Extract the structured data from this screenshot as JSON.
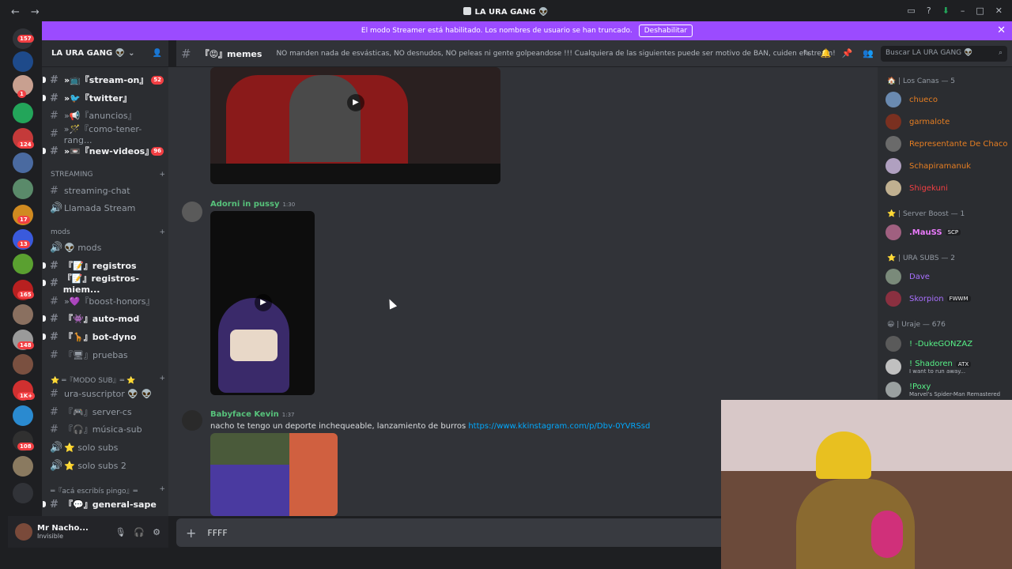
{
  "window": {
    "title": "LA URA GANG 👽"
  },
  "banner": {
    "text": "El modo Streamer está habilitado. Los nombres de usuario se han truncado.",
    "button": "Deshabilitar"
  },
  "server": {
    "name": "LA URA GANG 👽"
  },
  "guild_badges": [
    "157",
    "1",
    "124",
    "17",
    "13",
    "165",
    "148",
    "1K+",
    "108"
  ],
  "channels": {
    "items": [
      {
        "label": "»📺『stream-on』",
        "badge": "52"
      },
      {
        "label": "»🐦『twitter』",
        "badge": ""
      },
      {
        "label": "»📢『anuncios』",
        "badge": ""
      },
      {
        "label": "»🪄『como-tener-rang...",
        "badge": ""
      },
      {
        "label": "»📼『new-videos』",
        "badge": "96"
      },
      {
        "label": "streaming-chat",
        "badge": ""
      },
      {
        "label": "Llamada Stream",
        "badge": ""
      },
      {
        "label": "👽 mods",
        "badge": ""
      },
      {
        "label": "『📝』registros",
        "badge": ""
      },
      {
        "label": "『📝』registros-miem...",
        "badge": ""
      },
      {
        "label": "»💜『boost-honors』",
        "badge": ""
      },
      {
        "label": "『👾』auto-mod",
        "badge": ""
      },
      {
        "label": "『🦒』bot-dyno",
        "badge": ""
      },
      {
        "label": "『🖥』pruebas",
        "badge": ""
      },
      {
        "label": "ura-suscriptor 👽 👽",
        "badge": ""
      },
      {
        "label": "『🎮』server-cs",
        "badge": ""
      },
      {
        "label": "『🎧』música-sub",
        "badge": ""
      },
      {
        "label": "⭐ solo subs",
        "badge": ""
      },
      {
        "label": "⭐ solo subs 2",
        "badge": ""
      },
      {
        "label": "『💬』general-sape",
        "badge": ""
      }
    ],
    "categories": [
      "STREAMING",
      "mods",
      "⭐ ═『MODO SUB』═ ⭐",
      "═『acá escribís pingo』═"
    ]
  },
  "user": {
    "name": "Mr Nacho...",
    "status": "Invisible"
  },
  "header": {
    "channel": "『😡』memes",
    "topic": "NO manden nada de esvásticas, NO desnudos, NO peleas ni gente golpeandose !!! Cualquiera de las siguientes puede ser motivo de BAN, cuiden el stream!",
    "search_placeholder": "Buscar LA URA GANG 👽"
  },
  "messages": [
    {
      "author": "Adorni in pussy",
      "time": "1:30",
      "text": "",
      "color": "#57c27b"
    },
    {
      "author": "Babyface Kevin",
      "time": "1:37",
      "text": "nacho te tengo un deporte inchequeable, lanzamiento de burros ",
      "link": "https://www.kkinstagram.com/p/Dbv-0YVRSsd",
      "color": "#57c27b"
    }
  ],
  "composer": {
    "value": "FFFF"
  },
  "members": {
    "groups": [
      "🏠 | Los Canas — 5",
      "⭐ | Server Boost — 1",
      "⭐ | URA SUBS — 2",
      "😀 | Uraje — 676"
    ],
    "list": [
      {
        "name": "chueco",
        "color": "#e67e22"
      },
      {
        "name": "garmalote",
        "color": "#e67e22"
      },
      {
        "name": "Representante De Chaco",
        "color": "#e67e22"
      },
      {
        "name": "Schapiramanuk",
        "color": "#e67e22"
      },
      {
        "name": "Shigekuni",
        "color": "#f23f43"
      },
      {
        "name": ".MauSS",
        "color": "#e879f9",
        "tag": "SCP"
      },
      {
        "name": "Dave",
        "color": "#a970ff"
      },
      {
        "name": "Skorpion",
        "color": "#a970ff",
        "tag": "FWWM"
      },
      {
        "name": "! -DukeGONZAZ",
        "color": "#57f287"
      },
      {
        "name": "! Shadoren",
        "color": "#57f287",
        "tag": "ATX",
        "activity": "I want to run away..."
      },
      {
        "name": "!Poxy",
        "color": "#57f287",
        "activity": "Marvel's Spider-Man Remastered"
      }
    ]
  }
}
